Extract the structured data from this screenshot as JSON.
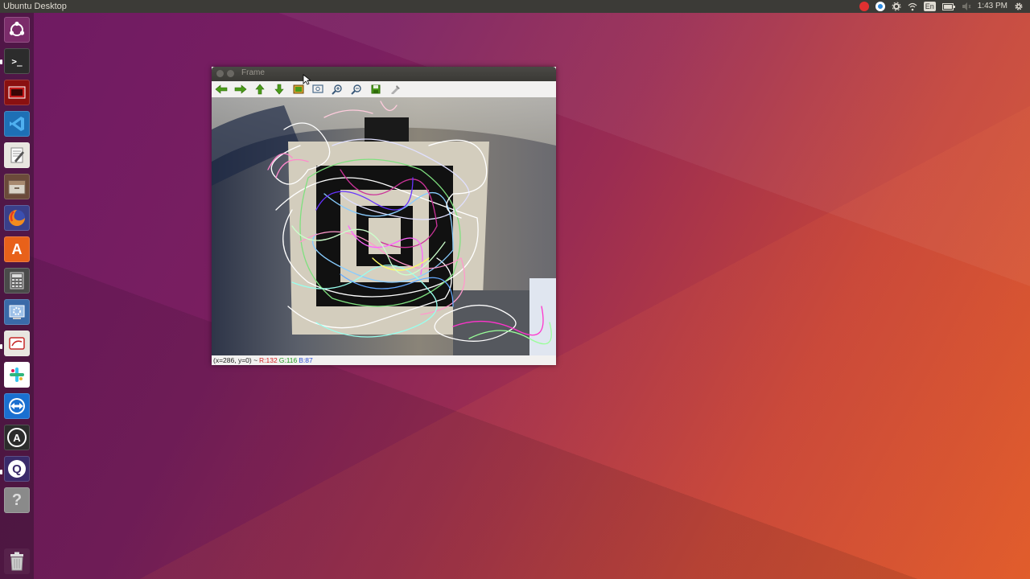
{
  "desktop": {
    "panel_title": "Ubuntu Desktop",
    "clock": "1:43 PM",
    "keyboard_lang": "En",
    "tray_icons": [
      "recording-indicator",
      "teamviewer-icon",
      "settings-sync-icon",
      "wifi-icon",
      "keyboard-lang-icon",
      "battery-icon",
      "volume-icon",
      "gear-icon"
    ]
  },
  "launcher": {
    "items": [
      {
        "name": "ubuntu-dash",
        "icon": "ubuntu-logo-icon"
      },
      {
        "name": "terminal",
        "icon": "terminal-icon",
        "glyph": ">_"
      },
      {
        "name": "screen-recorder",
        "icon": "recorder-icon"
      },
      {
        "name": "vscode",
        "icon": "vscode-icon"
      },
      {
        "name": "text-editor",
        "icon": "text-editor-icon"
      },
      {
        "name": "files",
        "icon": "file-manager-icon"
      },
      {
        "name": "firefox",
        "icon": "firefox-icon"
      },
      {
        "name": "software-center",
        "icon": "software-center-icon",
        "glyph": "A"
      },
      {
        "name": "calculator",
        "icon": "calculator-icon"
      },
      {
        "name": "system-settings",
        "icon": "system-settings-icon"
      },
      {
        "name": "screenshot-tool",
        "icon": "screenshot-icon"
      },
      {
        "name": "slack",
        "icon": "slack-icon"
      },
      {
        "name": "teamviewer",
        "icon": "teamviewer-icon"
      },
      {
        "name": "updater",
        "icon": "updater-icon",
        "glyph": "A"
      },
      {
        "name": "app-q",
        "icon": "q-app-icon",
        "glyph": "Q"
      },
      {
        "name": "help",
        "icon": "help-icon",
        "glyph": "?"
      },
      {
        "name": "trash",
        "icon": "trash-icon"
      }
    ]
  },
  "window": {
    "title": "Frame",
    "toolbar": [
      "pan-left-icon",
      "pan-right-icon",
      "pan-up-icon",
      "pan-down-icon",
      "zoom-fit-icon",
      "zoom-original-icon",
      "zoom-in-icon",
      "zoom-out-icon",
      "save-icon",
      "properties-icon"
    ],
    "status": {
      "coords": "(x=286, y=0) ~",
      "r": "R:132",
      "g": "G:116",
      "b": "B:87"
    }
  },
  "colors": {
    "panel_bg": "#3c3b37",
    "status_r": "#d42020",
    "status_g": "#1f9c1f",
    "status_b": "#2a4fd6",
    "toolbar_arrow": "#4b9b1a"
  }
}
